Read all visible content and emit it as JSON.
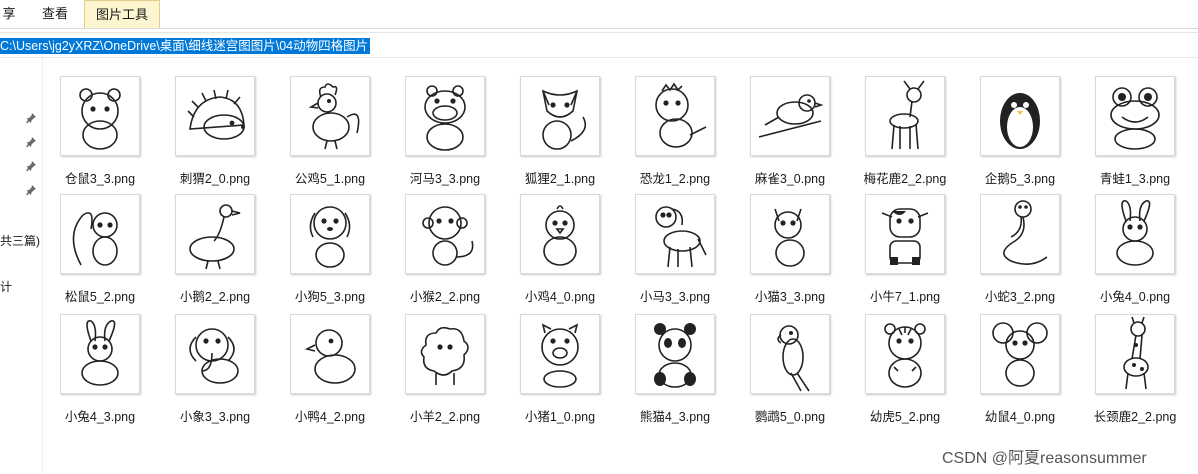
{
  "ribbon": {
    "tabs": [
      {
        "label": "享"
      },
      {
        "label": "查看"
      },
      {
        "label": "图片工具"
      }
    ]
  },
  "address": {
    "path": "C:\\Users\\jg2yXRZ\\OneDrive\\桌面\\细线迷宫图图片\\04动物四格图片"
  },
  "nav": {
    "items": [
      {
        "label": "共三篇)"
      },
      {
        "label": "计"
      }
    ]
  },
  "files": [
    {
      "name": "仓鼠3_3.png",
      "icon": "hamster"
    },
    {
      "name": "刺猬2_0.png",
      "icon": "hedgehog"
    },
    {
      "name": "公鸡5_1.png",
      "icon": "rooster"
    },
    {
      "name": "河马3_3.png",
      "icon": "hippo"
    },
    {
      "name": "狐狸2_1.png",
      "icon": "fox"
    },
    {
      "name": "恐龙1_2.png",
      "icon": "dinosaur"
    },
    {
      "name": "麻雀3_0.png",
      "icon": "sparrow"
    },
    {
      "name": "梅花鹿2_2.png",
      "icon": "deer"
    },
    {
      "name": "企鹅5_3.png",
      "icon": "penguin"
    },
    {
      "name": "青蛙1_3.png",
      "icon": "frog"
    },
    {
      "name": "松鼠5_2.png",
      "icon": "squirrel"
    },
    {
      "name": "小鹅2_2.png",
      "icon": "goose"
    },
    {
      "name": "小狗5_3.png",
      "icon": "puppy"
    },
    {
      "name": "小猴2_2.png",
      "icon": "monkey"
    },
    {
      "name": "小鸡4_0.png",
      "icon": "chick"
    },
    {
      "name": "小马3_3.png",
      "icon": "pony"
    },
    {
      "name": "小猫3_3.png",
      "icon": "kitten"
    },
    {
      "name": "小牛7_1.png",
      "icon": "calf"
    },
    {
      "name": "小蛇3_2.png",
      "icon": "snake"
    },
    {
      "name": "小兔4_0.png",
      "icon": "rabbit"
    },
    {
      "name": "小兔4_3.png",
      "icon": "rabbit"
    },
    {
      "name": "小象3_3.png",
      "icon": "elephant"
    },
    {
      "name": "小鸭4_2.png",
      "icon": "duckling"
    },
    {
      "name": "小羊2_2.png",
      "icon": "lamb"
    },
    {
      "name": "小猪1_0.png",
      "icon": "piglet"
    },
    {
      "name": "熊猫4_3.png",
      "icon": "panda"
    },
    {
      "name": "鹦鹉5_0.png",
      "icon": "parrot"
    },
    {
      "name": "幼虎5_2.png",
      "icon": "tiger-cub"
    },
    {
      "name": "幼鼠4_0.png",
      "icon": "mouse"
    },
    {
      "name": "长颈鹿2_2.png",
      "icon": "giraffe"
    }
  ],
  "watermark": {
    "text": "CSDN @阿夏reasonsummer"
  }
}
